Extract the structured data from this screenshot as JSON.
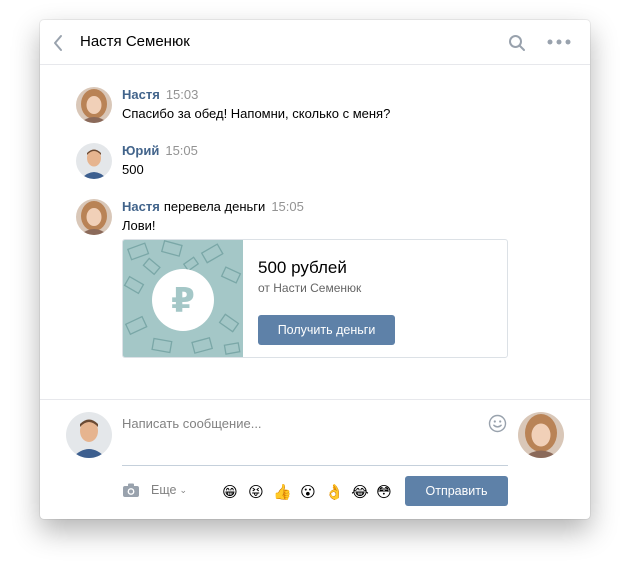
{
  "header": {
    "title": "Настя Семенюк"
  },
  "messages": [
    {
      "author": "Настя",
      "action": "",
      "time": "15:03",
      "text": "Спасибо за обед! Напомни, сколько с меня?"
    },
    {
      "author": "Юрий",
      "action": "",
      "time": "15:05",
      "text": "500"
    },
    {
      "author": "Настя",
      "action": "перевела деньги",
      "time": "15:05",
      "text": "Лови!"
    }
  ],
  "transfer": {
    "amount": "500 рублей",
    "from": "от Насти Семенюк",
    "button_label": "Получить деньги",
    "currency_symbol": "₽"
  },
  "composer": {
    "placeholder": "Написать сообщение...",
    "more_label": "Еще",
    "emojis": [
      "😁",
      "😝",
      "👍",
      "😮",
      "👌",
      "😂",
      "😳"
    ],
    "send_label": "Отправить"
  },
  "colors": {
    "accent": "#5e81a8",
    "author": "#42648b",
    "card_art": "#a4c7c7"
  }
}
